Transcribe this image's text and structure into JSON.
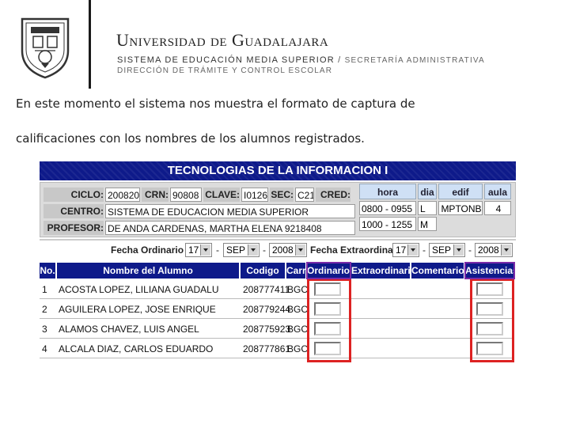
{
  "header": {
    "title": "Universidad de Guadalajara",
    "subtitle_main": "SISTEMA DE EDUCACIÓN MEDIA SUPERIOR",
    "subtitle_sep": "/",
    "subtitle_secondary": "SECRETARÍA ADMINISTRATIVA",
    "subtitle_line2": "DIRECCIÓN DE TRÁMITE Y CONTROL ESCOLAR"
  },
  "intro": {
    "line1": "En este momento el sistema nos muestra el formato de captura de",
    "line2": "calificaciones con los nombres de los alumnos registrados."
  },
  "app": {
    "banner": "TECNOLOGIAS DE LA INFORMACION I",
    "info": {
      "ciclo_label": "CICLO:",
      "ciclo_value": "200820",
      "crn_label": "CRN:",
      "crn_value": "90808",
      "clave_label": "CLAVE:",
      "clave_value": "I0126",
      "sec_label": "SEC:",
      "sec_value": "C21",
      "cred_label": "CRED:",
      "centro_label": "CENTRO:",
      "centro_value": "SISTEMA DE EDUCACION MEDIA SUPERIOR",
      "profesor_label": "PROFESOR:",
      "profesor_value": "DE ANDA CARDENAS, MARTHA ELENA 9218408"
    },
    "schedule": {
      "headers": [
        "hora",
        "dia",
        "edif",
        "aula"
      ],
      "rows": [
        [
          "0800 - 0955",
          "L",
          "MPTONB",
          "4"
        ],
        [
          "1000 - 1255",
          "M",
          "",
          ""
        ]
      ]
    },
    "dates": {
      "ordinario_label": "Fecha Ordinario",
      "ordinario": {
        "day": "17",
        "month": "SEP",
        "year": "2008"
      },
      "extra_label": "Fecha Extraordinario",
      "extra": {
        "day": "17",
        "month": "SEP",
        "year": "2008"
      },
      "dash": "-"
    },
    "grid": {
      "headers": [
        "No.",
        "Nombre del Alumno",
        "Codigo",
        "Carr",
        "Ordinario",
        "Extraordinario",
        "Comentario",
        "Asistencias"
      ],
      "rows": [
        {
          "no": "1",
          "name": "ACOSTA LOPEZ, LILIANA GUADALU",
          "code": "208777411",
          "carr": "BGC"
        },
        {
          "no": "2",
          "name": "AGUILERA LOPEZ, JOSE ENRIQUE",
          "code": "208779244",
          "carr": "BGC"
        },
        {
          "no": "3",
          "name": "ALAMOS CHAVEZ, LUIS ANGEL",
          "code": "208775923",
          "carr": "BGC"
        },
        {
          "no": "4",
          "name": "ALCALA DIAZ, CARLOS EDUARDO",
          "code": "208777861",
          "carr": "BGC"
        }
      ]
    }
  },
  "colors": {
    "banner_blue": "#0e1a8a",
    "highlight_red": "#dd2222",
    "highlight_purple": "#7a2aa8",
    "schedule_header": "#cfe0f5"
  }
}
